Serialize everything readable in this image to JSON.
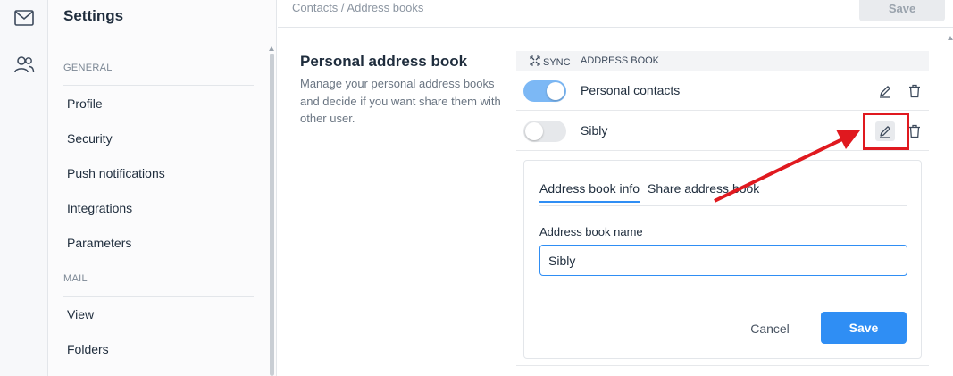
{
  "rail": {
    "icons": [
      "mail-icon",
      "contacts-icon"
    ]
  },
  "sidebar": {
    "title": "Settings",
    "sections": [
      {
        "label": "GENERAL",
        "items": [
          "Profile",
          "Security",
          "Push notifications",
          "Integrations",
          "Parameters"
        ]
      },
      {
        "label": "MAIL",
        "items": [
          "View",
          "Folders"
        ]
      }
    ]
  },
  "topbar": {
    "breadcrumb": "Contacts / Address books",
    "save_label": "Save"
  },
  "section": {
    "title": "Personal address book",
    "description": "Manage your personal address books and decide if you want share them with other user."
  },
  "table": {
    "headers": {
      "sync": "SYNC",
      "address_book": "ADDRESS BOOK"
    },
    "rows": [
      {
        "name": "Personal contacts",
        "sync": true
      },
      {
        "name": "Sibly",
        "sync": false
      }
    ]
  },
  "editor": {
    "tabs": [
      "Address book info",
      "Share address book"
    ],
    "active_tab": "Address book info",
    "field_label": "Address book name",
    "field_value": "Sibly",
    "cancel_label": "Cancel",
    "save_label": "Save"
  },
  "colors": {
    "accent": "#2f8ef4",
    "toggle_on": "#7cb8f5",
    "annotation": "#e0191f"
  }
}
